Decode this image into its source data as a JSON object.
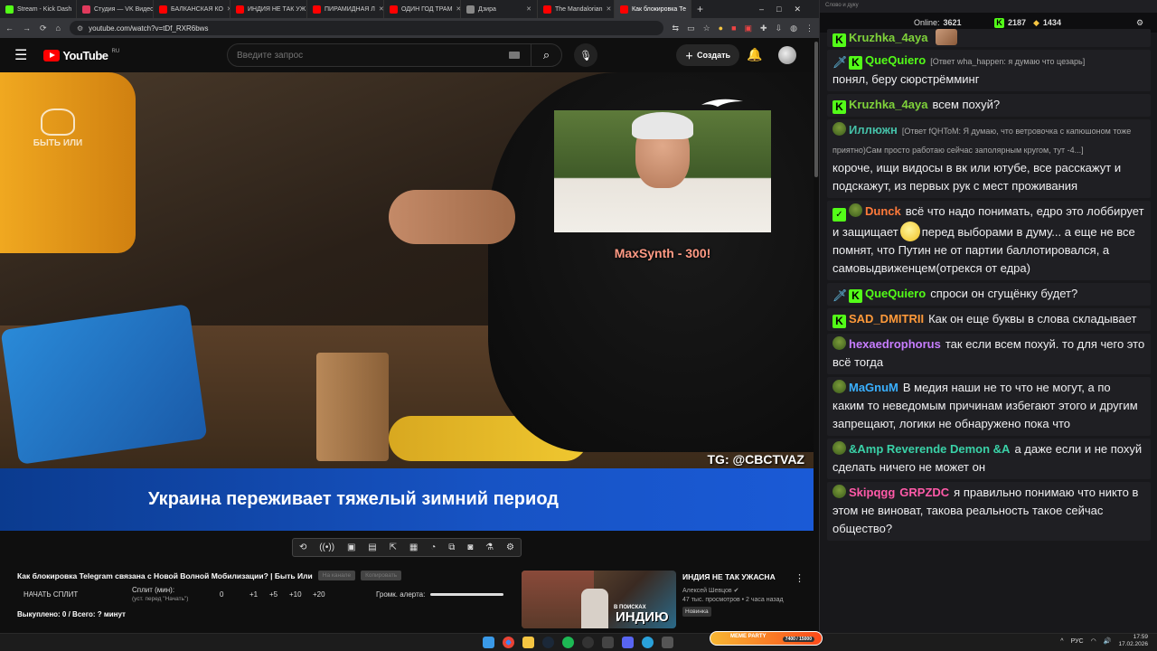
{
  "browser": {
    "tabs": [
      {
        "label": "Stream - Kick Dash",
        "color": "#53fc18"
      },
      {
        "label": "Студия — VK Видео",
        "color": "#e03a5c"
      },
      {
        "label": "БАЛКАНСКАЯ КО",
        "color": "#ff0000"
      },
      {
        "label": "ИНДИЯ НЕ ТАК УЖ",
        "color": "#ff0000"
      },
      {
        "label": "ПИРАМИДНАЯ Л",
        "color": "#ff0000"
      },
      {
        "label": "ОДИН ГОД ТРАМ",
        "color": "#ff0000"
      },
      {
        "label": "Дзира",
        "color": "#888888"
      },
      {
        "label": "The Mandalorian",
        "color": "#ff0000"
      },
      {
        "label": "Как блокировка Те",
        "color": "#ff0000"
      }
    ],
    "new_tab": "+",
    "url": "youtube.com/watch?v=tDf_RXR6bws"
  },
  "youtube": {
    "logo": "YouTube",
    "region": "RU",
    "search_placeholder": "Введите запрос",
    "create_label": "Создать"
  },
  "video": {
    "subtitle": "Украина переживает тяжелый зимний период",
    "watermark": "TG: @CBCTVAZ",
    "donation": "MaxSynth - 300!",
    "channel_logo": "БЫТЬ ИЛИ"
  },
  "below": {
    "title": "Как блокировка Telegram связана с Новой Волной Мобилизации? | Быть Или",
    "chip1": "На канале",
    "chip2": "Копировать",
    "split_button": "НАЧАТЬ СПЛИТ",
    "split_label": "Сплит (мин):",
    "split_hint": "(уст. перед \"Начать\")",
    "split_value": "0",
    "increments": [
      "+1",
      "+5",
      "+10",
      "+20"
    ],
    "alert_label": "Громк. алерта:",
    "spent": "Выкуплено: 0 / Всего: ? минут"
  },
  "recommendation": {
    "title": "ИНДИЯ НЕ ТАК УЖАСНА",
    "channel": "Алексей Шевцов",
    "meta": "47 тыс. просмотров • 2 часа назад",
    "badge": "Новинка",
    "thumb_small": "В ПОИСКАХ",
    "thumb_big": "ИНДИЮ"
  },
  "chat": {
    "window_title": "Слово и дуку",
    "online_label": "Online:",
    "online": "3621",
    "kick_count": "2187",
    "other_count": "1434",
    "messages": [
      {
        "user": "Kruzhka_4aya",
        "color": "#7fd23a",
        "reply": "",
        "text": ""
      },
      {
        "user": "QueQuiero",
        "color": "#53fc18",
        "reply": "[Ответ wha_happen: я думаю что цезарь]",
        "text": "понял, беру сюрстрёмминг"
      },
      {
        "user": "Kruzhka_4aya",
        "color": "#7fd23a",
        "reply": "",
        "text": "всем похуй?"
      },
      {
        "user": "Иллюжн",
        "color": "#45c0a8",
        "reply": "[Ответ fQHToM: Я думаю, что ветровочка с капюшоном тоже приятно)Сам просто работаю сейчас заполярным кругом, тут -4...]",
        "text": "короче, ищи видосы в вк или ютубе, все расскажут и подскажут, из первых рук с мест проживания"
      },
      {
        "user": "Dunck",
        "color": "#ff7a3a",
        "reply": "",
        "text": "всё что надо понимать, едро это лоббирует и защищает",
        "text2": "перед выборами в думу... а еще не все помнят, что Путин не от партии баллотировался, а самовыдвиженцем(отрекся от едра)"
      },
      {
        "user": "QueQuiero",
        "color": "#53fc18",
        "reply": "",
        "text": "спроси он сгущёнку будет?"
      },
      {
        "user": "SAD_DMITRII",
        "color": "#ff9a3a",
        "reply": "",
        "text": "Как он еще буквы в слова складывает"
      },
      {
        "user": "hexaedrophorus",
        "color": "#c77dff",
        "reply": "",
        "text": "так если всем похуй. то для чего это всё тогда"
      },
      {
        "user": "MaGnuM",
        "color": "#3ab0ff",
        "reply": "",
        "text": "В медия наши не то что не могут, а по каким то неведомым причинам избегают этого и другим запрещают, логики не обнаружено пока что"
      },
      {
        "user": "&Amp Reverende Demon &A",
        "color": "#3ad2a8",
        "reply": "",
        "text": "а даже если и не похуй сделать ничего не может он"
      },
      {
        "user": "Skipqgg",
        "color": "#ff5aa8",
        "user2": "GRPZDC",
        "reply": "",
        "text": "я правильно понимаю что никто в этом не виноват, такова реальность такое сейчас общество?"
      }
    ]
  },
  "taskbar": {
    "meme_label": "MEME PARTY",
    "meme_count": "7400 / 15000",
    "lang": "РУС",
    "time": "17:59",
    "date": "17.02.2026"
  }
}
